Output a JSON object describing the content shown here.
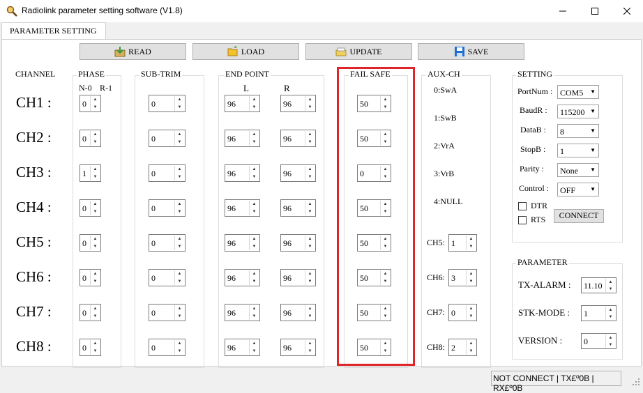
{
  "window": {
    "title": "Radiolink parameter setting software (V1.8)"
  },
  "tab": {
    "label": "PARAMETER SETTING"
  },
  "toolbar": {
    "read": "READ",
    "load": "LOAD",
    "update": "UPDATE",
    "save": "SAVE"
  },
  "groups": {
    "channel": "CHANNEL",
    "phase": "PHASE",
    "subtrim": "SUB-TRIM",
    "endpoint": "END POINT",
    "failsafe": "FAIL SAFE",
    "auxch": "AUX-CH",
    "setting": "SETTING",
    "parameter": "PARAMETER"
  },
  "phase_header": {
    "n": "N-0",
    "r": "R-1"
  },
  "endpoint_header": {
    "l": "L",
    "r": "R"
  },
  "channels": [
    {
      "label": "CH1 :",
      "phase": "0",
      "subtrim": "0",
      "ep_l": "96",
      "ep_r": "96",
      "failsafe": "50"
    },
    {
      "label": "CH2 :",
      "phase": "0",
      "subtrim": "0",
      "ep_l": "96",
      "ep_r": "96",
      "failsafe": "50"
    },
    {
      "label": "CH3 :",
      "phase": "1",
      "subtrim": "0",
      "ep_l": "96",
      "ep_r": "96",
      "failsafe": "0"
    },
    {
      "label": "CH4 :",
      "phase": "0",
      "subtrim": "0",
      "ep_l": "96",
      "ep_r": "96",
      "failsafe": "50"
    },
    {
      "label": "CH5 :",
      "phase": "0",
      "subtrim": "0",
      "ep_l": "96",
      "ep_r": "96",
      "failsafe": "50"
    },
    {
      "label": "CH6 :",
      "phase": "0",
      "subtrim": "0",
      "ep_l": "96",
      "ep_r": "96",
      "failsafe": "50"
    },
    {
      "label": "CH7 :",
      "phase": "0",
      "subtrim": "0",
      "ep_l": "96",
      "ep_r": "96",
      "failsafe": "50"
    },
    {
      "label": "CH8 :",
      "phase": "0",
      "subtrim": "0",
      "ep_l": "96",
      "ep_r": "96",
      "failsafe": "50"
    }
  ],
  "aux_map": [
    "0:SwA",
    "1:SwB",
    "2:VrA",
    "3:VrB",
    "4:NULL"
  ],
  "aux_channels": [
    {
      "label": "CH5:",
      "value": "1"
    },
    {
      "label": "CH6:",
      "value": "3"
    },
    {
      "label": "CH7:",
      "value": "0"
    },
    {
      "label": "CH8:",
      "value": "2"
    }
  ],
  "setting": {
    "portnum": {
      "label": "PortNum :",
      "value": "COM5"
    },
    "baudr": {
      "label": "BaudR :",
      "value": "115200"
    },
    "datab": {
      "label": "DataB :",
      "value": "8"
    },
    "stopb": {
      "label": "StopB :",
      "value": "1"
    },
    "parity": {
      "label": "Parity :",
      "value": "None"
    },
    "control": {
      "label": "Control :",
      "value": "OFF"
    },
    "dtr": "DTR",
    "rts": "RTS",
    "connect": "CONNECT"
  },
  "parameter": {
    "tx_alarm": {
      "label": "TX-ALARM :",
      "value": "11.10"
    },
    "stk_mode": {
      "label": "STK-MODE :",
      "value": "1"
    },
    "version": {
      "label": "VERSION :",
      "value": "0"
    }
  },
  "status": {
    "text": "NOT CONNECT | TX£º0B | RX£º0B"
  },
  "colors": {
    "highlight": "#e0252a",
    "save_icon": "#1e6fd0",
    "folder_icon": "#f2c230",
    "read_icon": "#3a9a3a"
  }
}
